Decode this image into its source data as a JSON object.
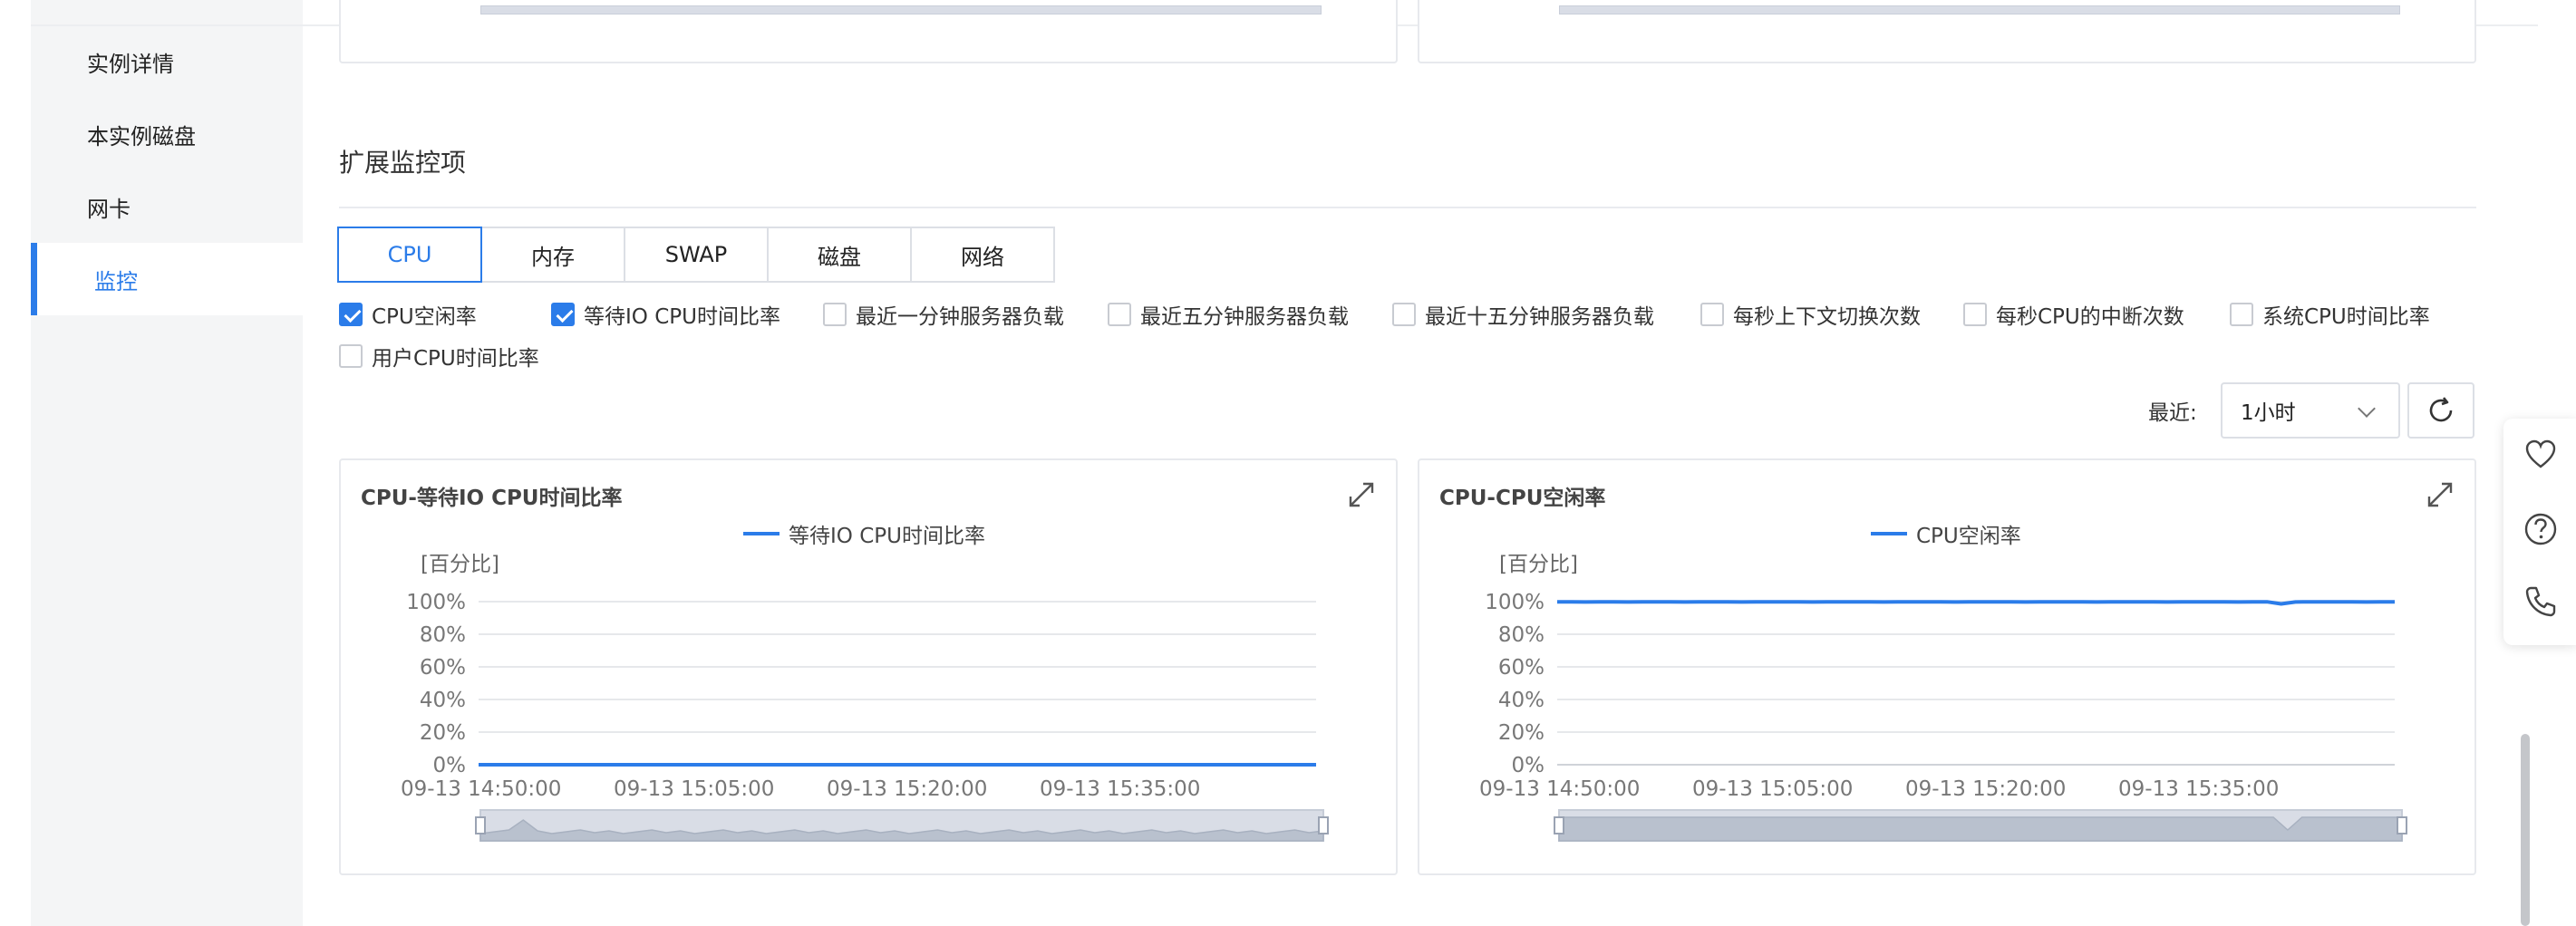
{
  "sidebar": {
    "items": [
      {
        "label": "实例详情",
        "active": false
      },
      {
        "label": "本实例磁盘",
        "active": false
      },
      {
        "label": "网卡",
        "active": false
      },
      {
        "label": "监控",
        "active": true
      }
    ]
  },
  "section": {
    "title": "扩展监控项"
  },
  "tabs": [
    {
      "label": "CPU",
      "active": true
    },
    {
      "label": "内存",
      "active": false
    },
    {
      "label": "SWAP",
      "active": false
    },
    {
      "label": "磁盘",
      "active": false
    },
    {
      "label": "网络",
      "active": false
    }
  ],
  "metrics": [
    {
      "label": "CPU空闲率",
      "checked": true
    },
    {
      "label": "等待IO CPU时间比率",
      "checked": true
    },
    {
      "label": "最近一分钟服务器负载",
      "checked": false
    },
    {
      "label": "最近五分钟服务器负载",
      "checked": false
    },
    {
      "label": "最近十五分钟服务器负载",
      "checked": false
    },
    {
      "label": "每秒上下文切换次数",
      "checked": false
    },
    {
      "label": "每秒CPU的中断次数",
      "checked": false
    },
    {
      "label": "系统CPU时间比率",
      "checked": false
    },
    {
      "label": "用户CPU时间比率",
      "checked": false
    }
  ],
  "time_range": {
    "label": "最近:",
    "selected": "1小时"
  },
  "icons": {
    "refresh": "refresh-icon",
    "expand": "expand-icon",
    "favorite": "heart-icon",
    "help": "help-icon",
    "phone": "phone-icon",
    "dropdown": "chevron-down-icon"
  },
  "colors": {
    "accent": "#2b7ce9",
    "grid": "#e6e8eb",
    "zoom_fill": "#d9dde6"
  },
  "chart_data": [
    {
      "type": "line",
      "title": "CPU-等待IO CPU时间比率",
      "unit_label": "[百分比]",
      "y_ticks": [
        "100%",
        "80%",
        "60%",
        "40%",
        "20%",
        "0%"
      ],
      "ylim": [
        0,
        100
      ],
      "x_ticks": [
        "09-13 14:50:00",
        "09-13 15:05:00",
        "09-13 15:20:00",
        "09-13 15:35:00"
      ],
      "series": [
        {
          "name": "等待IO CPU时间比率",
          "values": [
            0,
            0,
            0,
            0,
            0,
            0,
            0,
            0,
            0,
            0,
            0,
            0,
            0,
            0,
            0,
            0,
            0,
            0,
            0,
            0,
            0,
            0,
            0,
            0,
            0,
            0,
            0,
            0,
            0,
            0,
            0,
            0,
            0,
            0,
            0,
            0,
            0,
            0,
            0,
            0,
            0,
            0,
            0,
            0,
            0,
            0,
            0,
            0,
            0,
            0,
            0,
            0,
            0,
            0,
            0,
            0,
            0,
            0,
            0,
            0
          ]
        }
      ],
      "legend": "top-center",
      "grid": true
    },
    {
      "type": "line",
      "title": "CPU-CPU空闲率",
      "unit_label": "[百分比]",
      "y_ticks": [
        "100%",
        "80%",
        "60%",
        "40%",
        "20%",
        "0%"
      ],
      "ylim": [
        0,
        100
      ],
      "x_ticks": [
        "09-13 14:50:00",
        "09-13 15:05:00",
        "09-13 15:20:00",
        "09-13 15:35:00"
      ],
      "series": [
        {
          "name": "CPU空闲率",
          "values": [
            99.9,
            99.9,
            99.8,
            99.9,
            99.9,
            99.8,
            99.9,
            99.9,
            99.9,
            99.8,
            99.9,
            99.9,
            99.9,
            99.8,
            99.9,
            99.9,
            99.9,
            99.9,
            99.8,
            99.9,
            99.9,
            99.9,
            99.9,
            99.8,
            99.9,
            99.9,
            99.9,
            99.9,
            99.8,
            99.9,
            99.9,
            99.9,
            99.9,
            99.8,
            99.9,
            99.9,
            99.9,
            99.9,
            99.8,
            99.9,
            99.9,
            99.9,
            99.9,
            99.8,
            99.9,
            99.9,
            99.9,
            99.9,
            99.8,
            99.9,
            99.9,
            98.6,
            99.8,
            99.9,
            99.9,
            99.9,
            99.9,
            99.8,
            99.9,
            99.9
          ]
        }
      ],
      "legend": "top-center",
      "grid": true
    }
  ]
}
